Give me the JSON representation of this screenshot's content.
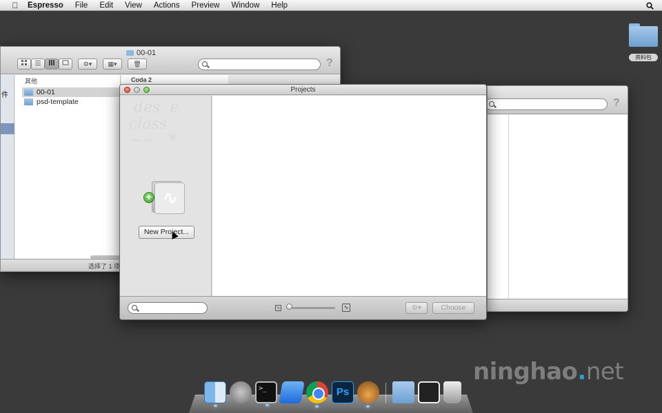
{
  "menubar": {
    "app_name": "Espresso",
    "items": [
      "File",
      "Edit",
      "View",
      "Actions",
      "Preview",
      "Window",
      "Help"
    ]
  },
  "desktop": {
    "folder_label": "资料包"
  },
  "finder_window": {
    "title": "00-01",
    "sidebar_partial_text": "件",
    "column1_header": "其他",
    "column2_header": "Coda 2",
    "items": [
      {
        "name": "00-01",
        "selected": true
      },
      {
        "name": "psd-template",
        "selected": false
      }
    ],
    "status": "选择了 1 项"
  },
  "projects_dialog": {
    "title": "Projects",
    "new_project_label": "New Project...",
    "choose_label": "Choose",
    "slider_value": 0.0
  },
  "watermark": {
    "brand": "ninghao",
    "dot": ".",
    "tld": "net"
  },
  "dock": {
    "icons": [
      "finder-icon",
      "launchpad-icon",
      "terminal-icon",
      "ipad-simulator-icon",
      "chrome-icon",
      "photoshop-icon",
      "espresso-icon",
      "downloads-folder-icon",
      "screenshot-icon",
      "trash-icon"
    ],
    "ps_label": "Ps"
  }
}
